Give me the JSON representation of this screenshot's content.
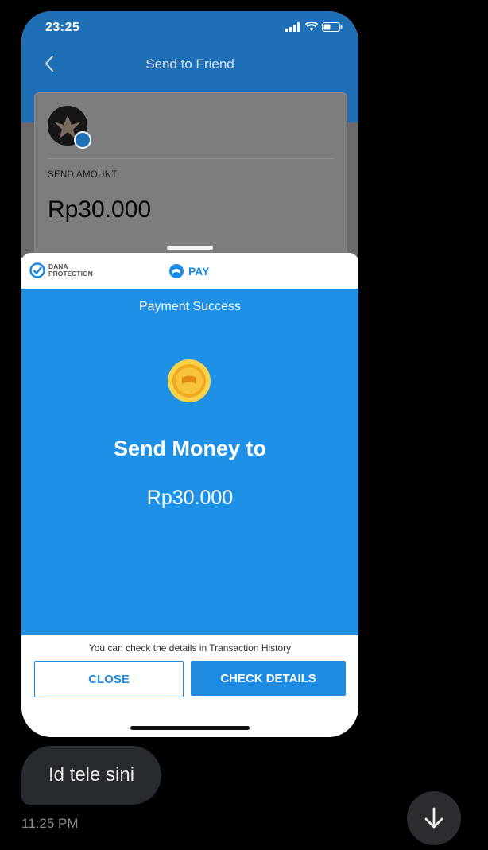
{
  "status_bar": {
    "time": "23:25",
    "icons": [
      "signal-icon",
      "wifi-icon",
      "battery-icon"
    ]
  },
  "navbar": {
    "title": "Send to Friend",
    "back_icon": "chevron-left-icon"
  },
  "card": {
    "send_label": "SEND AMOUNT",
    "amount": "Rp30.000"
  },
  "sheet": {
    "logo_dana_line1": "DANA",
    "logo_dana_line2": "PROTECTION",
    "pay_label": "PAY",
    "title": "Payment Success",
    "headline": "Send Money to",
    "amount": "Rp30.000",
    "note": "You can check the details in Transaction History",
    "close_label": "CLOSE",
    "details_label": "CHECK DETAILS"
  },
  "chat": {
    "message": "Id tele sini",
    "time": "11:25 PM"
  },
  "colors": {
    "app_blue": "#1f6fb7",
    "success_blue": "#1e90e6",
    "button_blue": "#1e8ae0",
    "bubble": "#272a2f"
  }
}
